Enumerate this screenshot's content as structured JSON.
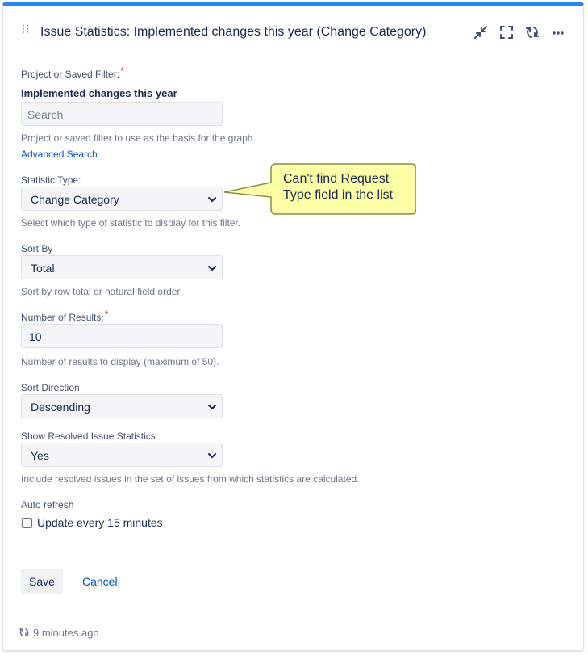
{
  "gadget": {
    "title": "Issue Statistics: Implemented changes this year (Change Category)",
    "header_icons": [
      "minimize-icon",
      "fullscreen-icon",
      "refresh-icon",
      "more-icon"
    ]
  },
  "form": {
    "filter": {
      "label": "Project or Saved Filter:",
      "required_mark": "*",
      "selected_value": "Implemented changes this year",
      "placeholder": "Search",
      "help": "Project or saved filter to use as the basis for the graph.",
      "advanced_link": "Advanced Search"
    },
    "statistic_type": {
      "label": "Statistic Type:",
      "value": "Change Category",
      "help": "Select which type of statistic to display for this filter."
    },
    "sort_by": {
      "label": "Sort By",
      "value": "Total",
      "help": "Sort by row total or natural field order."
    },
    "num_results": {
      "label": "Number of Results:",
      "required_mark": "*",
      "value": "10",
      "help": "Number of results to display (maximum of 50)."
    },
    "sort_direction": {
      "label": "Sort Direction",
      "value": "Descending"
    },
    "show_resolved": {
      "label": "Show Resolved Issue Statistics",
      "value": "Yes",
      "help": "Include resolved issues in the set of issues from which statistics are calculated."
    },
    "auto_refresh": {
      "label": "Auto refresh",
      "checkbox_label": "Update every 15 minutes",
      "checked": false
    },
    "buttons": {
      "save": "Save",
      "cancel": "Cancel"
    }
  },
  "footer": {
    "updated": "9 minutes ago"
  },
  "callout": {
    "text": "Can't find Request Type field in the list",
    "fill": "#ffffa5",
    "border": "#8c8c4a"
  },
  "colors": {
    "accent_top": "#2684ff",
    "link": "#0052cc",
    "required": "#de350b"
  }
}
